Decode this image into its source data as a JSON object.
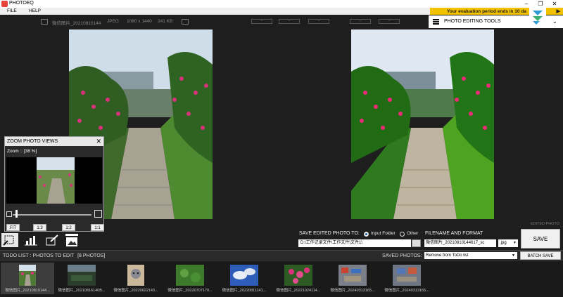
{
  "window": {
    "title": "PHOTOEQ",
    "minimize": "–",
    "restore": "❐",
    "close": "✕"
  },
  "menu": {
    "file": "FILE",
    "help": "HELP"
  },
  "banner": {
    "text": "Your evaluation period ends in 10 da",
    "arrow": "▶"
  },
  "toolbar": {
    "filename": "微信图片_20210810144",
    "format": "JPEG",
    "dimensions": "1080 x 1440",
    "size": "241 KB",
    "boxes": [
      "-",
      "-",
      "-",
      "-",
      "-"
    ]
  },
  "tools_button": {
    "label": "PHOTO EDITING TOOLS",
    "chevron": "⌄"
  },
  "main": {
    "edited_label": "EDITED PHOTO"
  },
  "zoom_panel": {
    "title": "ZOOM PHOTO VIEWS",
    "close": "✕",
    "zoom_text": "Zoom :: [38 %]",
    "zoom_level_percent": 38,
    "buttons": [
      "FIT",
      "1:3",
      "1:2",
      "1:1"
    ]
  },
  "save": {
    "title": "SAVE EDITED PHOTO TO:",
    "option_input": "Input Folder",
    "option_other": "Other",
    "selected": "Input Folder",
    "folder_path": "D:\\工作记录文件\\工作文件\\文件1\\",
    "format_title": "FILENAME AND FORMAT",
    "filename": "微信图片_20210810144617_sc",
    "format": ".jpg",
    "button": "SAVE"
  },
  "todo": {
    "label": "TODO LIST : PHOTOS TO EDIT",
    "count": "[8 PHOTOS]",
    "saved_label": "SAVED PHOTOS:",
    "saved_option": "Remove from ToDo list",
    "batch_button": "BATCH SAVE"
  },
  "thumbnails": [
    {
      "caption": "微信图片_20210810144..."
    },
    {
      "caption": "微信图片_20210816140B..."
    },
    {
      "caption": "微信图片_20220622143..."
    },
    {
      "caption": "微信图片_20220707170..."
    },
    {
      "caption": "微信图片_20220811141..."
    },
    {
      "caption": "微信图片_20221024114..."
    },
    {
      "caption": "微信图片_20240313165..."
    },
    {
      "caption": "微信图片_20240313165..."
    }
  ],
  "colors": {
    "accent": "#f2c200",
    "bg": "#1e1e1e",
    "app_icon": "#e8433a"
  }
}
